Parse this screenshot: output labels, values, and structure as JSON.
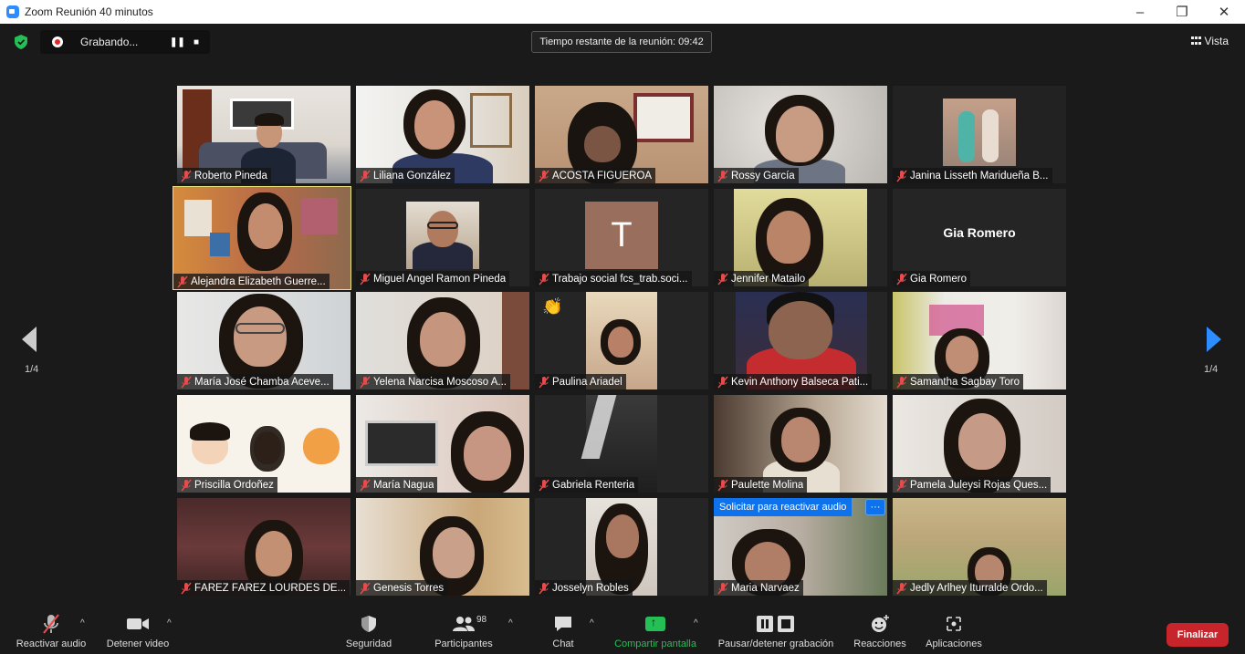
{
  "window": {
    "title": "Zoom Reunión 40 minutos",
    "minimize": "–",
    "restore": "❐",
    "close": "✕"
  },
  "topbar": {
    "recording_label": "Grabando...",
    "pause_symbol": "❚❚",
    "stop_symbol": "■",
    "timer_text": "Tiempo restante de la reunión: 09:42",
    "view_label": "Vista"
  },
  "pagination": {
    "left": "1/4",
    "right": "1/4"
  },
  "participants": [
    {
      "name": "Roberto Pineda"
    },
    {
      "name": "Liliana González"
    },
    {
      "name": "ACOSTA FIGUEROA"
    },
    {
      "name": "Rossy García"
    },
    {
      "name": "Janina Lisseth Maridueña B..."
    },
    {
      "name": "Alejandra Elizabeth Guerre..."
    },
    {
      "name": "Miguel Angel Ramon Pineda"
    },
    {
      "name": "Trabajo social fcs_trab.soci...",
      "initial": "T"
    },
    {
      "name": "Jennifer Matailo"
    },
    {
      "name": "Gia Romero",
      "display_name": "Gia Romero"
    },
    {
      "name": "María José Chamba Aceve..."
    },
    {
      "name": "Yelena Narcisa Moscoso A..."
    },
    {
      "name": "Paulina Ariadel"
    },
    {
      "name": "Kevin Anthony Balseca Pati..."
    },
    {
      "name": "Samantha  Sagbay Toro"
    },
    {
      "name": "Priscilla  Ordoñez"
    },
    {
      "name": "María Nagua"
    },
    {
      "name": "Gabriela Renteria"
    },
    {
      "name": "Paulette Molina"
    },
    {
      "name": "Pamela Juleysi Rojas Ques..."
    },
    {
      "name": "FÁREZ FÁREZ LOURDES DE..."
    },
    {
      "name": "Genesis Torres"
    },
    {
      "name": "Josselyn Robles"
    },
    {
      "name": "Maria Narvaez",
      "request_text": "Solicitar para reactivar audio",
      "more": "···"
    },
    {
      "name": "Jedly Arlhey Iturralde Ordo..."
    }
  ],
  "toolbar": {
    "unmute": "Reactivar audio",
    "stop_video": "Detener video",
    "security": "Seguridad",
    "participants": "Participantes",
    "participants_count": "98",
    "chat": "Chat",
    "share": "Compartir pantalla",
    "pause_recording": "Pausar/detener grabación",
    "reactions": "Reacciones",
    "apps": "Aplicaciones",
    "end": "Finalizar",
    "caret": "^"
  },
  "colors": {
    "accent": "#2d8cff",
    "share_green": "#25c055",
    "end_red": "#c7252b",
    "active_speaker": "#e9e27a"
  }
}
